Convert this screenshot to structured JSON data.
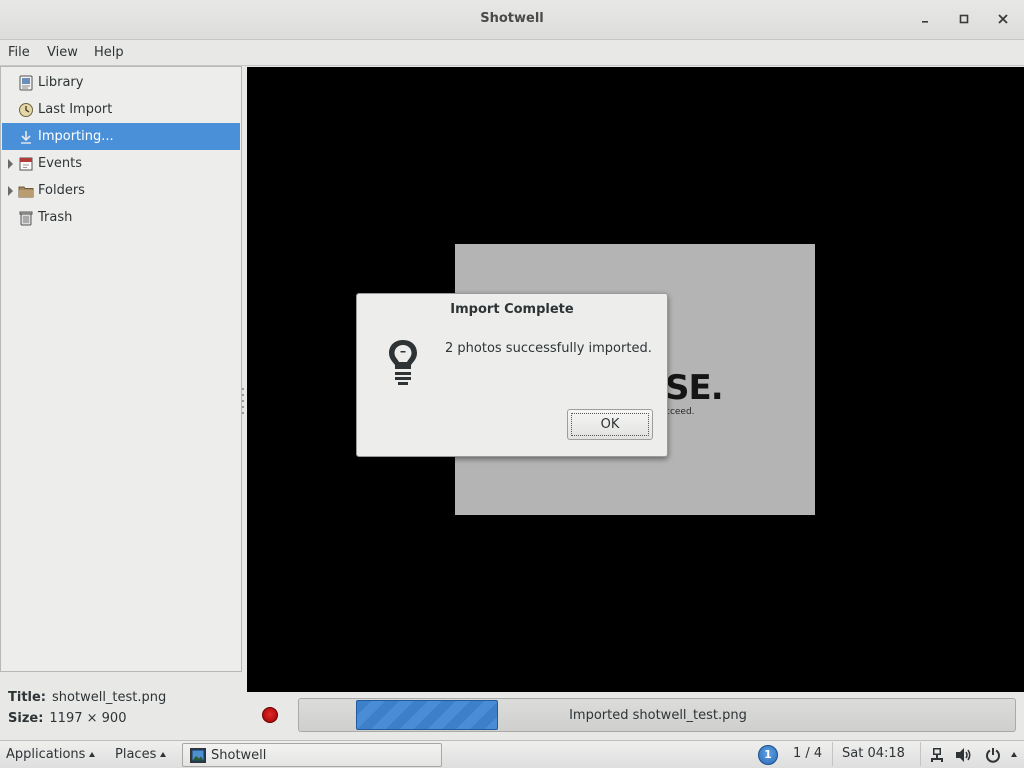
{
  "window": {
    "title": "Shotwell",
    "controls": {
      "minimize": "minimize-icon",
      "maximize": "maximize-icon",
      "close": "close-icon"
    }
  },
  "menubar": {
    "items": [
      "File",
      "View",
      "Help"
    ]
  },
  "sidebar": {
    "items": [
      {
        "label": "Library",
        "icon": "library-icon",
        "selected": false,
        "expandable": false
      },
      {
        "label": "Last Import",
        "icon": "last-import-icon",
        "selected": false,
        "expandable": false
      },
      {
        "label": "Importing...",
        "icon": "import-arrow-icon",
        "selected": true,
        "expandable": false
      },
      {
        "label": "Events",
        "icon": "events-icon",
        "selected": false,
        "expandable": true
      },
      {
        "label": "Folders",
        "icon": "folder-icon",
        "selected": false,
        "expandable": true
      },
      {
        "label": "Trash",
        "icon": "trash-icon",
        "selected": false,
        "expandable": false
      }
    ]
  },
  "metadata": {
    "title_label": "Title:",
    "title_value": "shotwell_test.png",
    "size_label": "Size:",
    "size_value": "1197 × 900"
  },
  "viewer": {
    "photo_logo_text": "SE.",
    "photo_tagline_text": "cceed."
  },
  "status": {
    "progress_text": "Imported shotwell_test.png",
    "stop_icon": "stop-icon"
  },
  "dialog": {
    "title": "Import Complete",
    "message": "2 photos successfully imported.",
    "ok_label": "OK",
    "icon": "lightbulb-info-icon"
  },
  "panel": {
    "applications_label": "Applications",
    "places_label": "Places",
    "task_label": "Shotwell",
    "workspace_number": "1",
    "workspace_indicator": "1 / 4",
    "clock": "Sat 04:18",
    "tray_icons": [
      "network-icon",
      "volume-icon",
      "power-icon"
    ]
  },
  "colors": {
    "selection": "#4a90d9",
    "progress": "#3d7fc9",
    "stop": "#cc0000"
  }
}
